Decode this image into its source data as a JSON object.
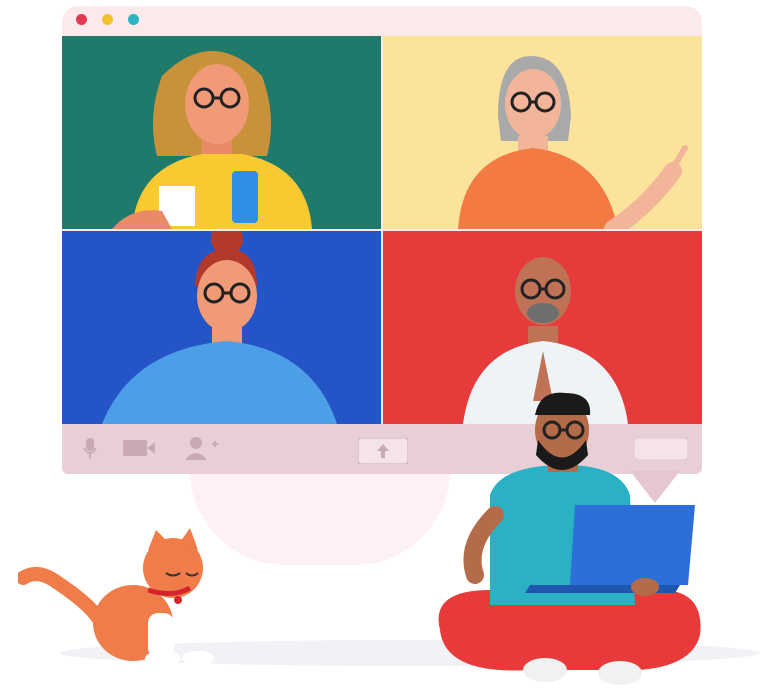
{
  "window": {
    "traffic_lights": [
      "#e23b4e",
      "#f2c12e",
      "#2bb3c4"
    ],
    "frame_color": "#fbe9ec"
  },
  "tiles": [
    {
      "name": "participant-woman-curly-hair",
      "bg": "#1f7a6b"
    },
    {
      "name": "participant-woman-gray-hair",
      "bg": "#fbe39c"
    },
    {
      "name": "participant-woman-red-bun",
      "bg": "#2554c7"
    },
    {
      "name": "participant-man-bald",
      "bg": "#e63b3b"
    }
  ],
  "toolbar": {
    "items": [
      "microphone-icon",
      "camera-icon",
      "add-person-icon",
      "share-screen-icon",
      "blank-pill-button"
    ],
    "color": "#e8cfd6"
  }
}
